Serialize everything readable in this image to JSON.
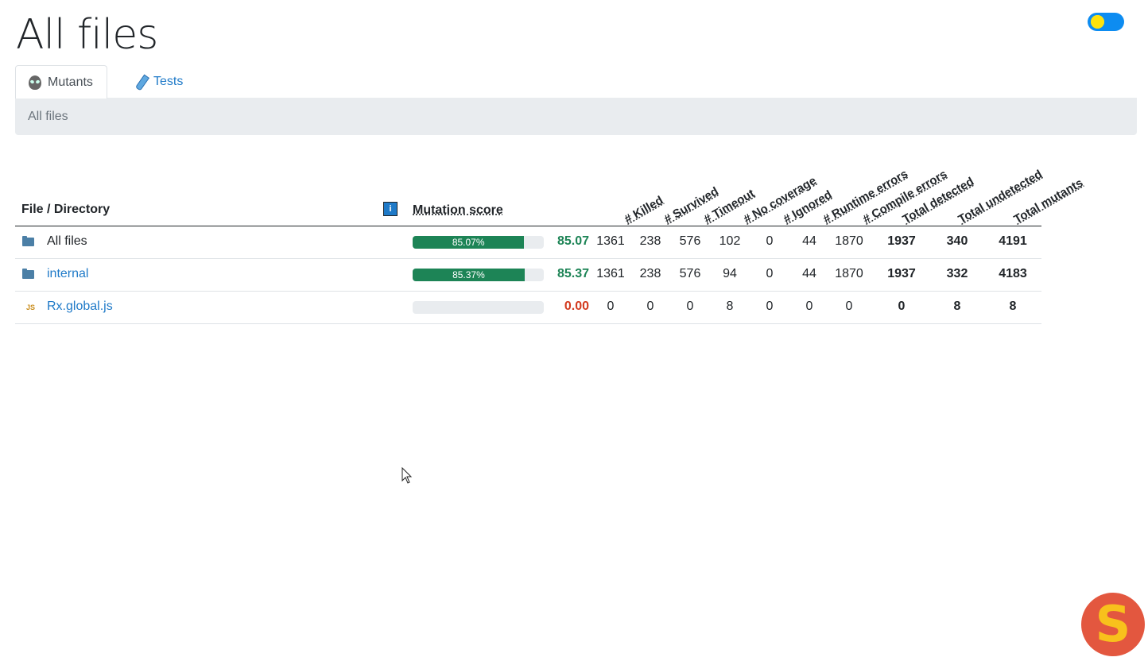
{
  "page": {
    "title": "All files"
  },
  "tabs": [
    {
      "label": "Mutants",
      "icon": "alien-icon",
      "active": true
    },
    {
      "label": "Tests",
      "icon": "test-tube-icon",
      "active": false
    }
  ],
  "breadcrumb": {
    "label": "All files"
  },
  "table": {
    "headers": {
      "file": "File / Directory",
      "info": "i",
      "score": "Mutation score",
      "killed": "# Killed",
      "survived": "# Survived",
      "timeout": "# Timeout",
      "no_coverage": "# No coverage",
      "ignored": "# Ignored",
      "runtime_errors": "# Runtime errors",
      "compile_errors": "# Compile errors",
      "total_detected": "Total detected",
      "total_undetected": "Total undetected",
      "total_mutants": "Total mutants"
    },
    "rows": [
      {
        "name": "All files",
        "type": "folder",
        "progress_label": "85.07%",
        "progress": 85.07,
        "score": "85.07",
        "score_color": "#1d8456",
        "killed": "1361",
        "survived": "238",
        "timeout": "576",
        "no_coverage": "102",
        "ignored": "0",
        "runtime_errors": "44",
        "compile_errors": "1870",
        "total_detected": "1937",
        "total_undetected": "340",
        "total_mutants": "4191"
      },
      {
        "name": "internal",
        "type": "folder",
        "progress_label": "85.37%",
        "progress": 85.37,
        "score": "85.37",
        "score_color": "#1d8456",
        "killed": "1361",
        "survived": "238",
        "timeout": "576",
        "no_coverage": "94",
        "ignored": "0",
        "runtime_errors": "44",
        "compile_errors": "1870",
        "total_detected": "1937",
        "total_undetected": "332",
        "total_mutants": "4183"
      },
      {
        "name": "Rx.global.js",
        "type": "js",
        "icon_text": "JS",
        "progress_label": "",
        "progress": 0,
        "score": "0.00",
        "score_color": "#d33b1f",
        "killed": "0",
        "survived": "0",
        "timeout": "0",
        "no_coverage": "8",
        "ignored": "0",
        "runtime_errors": "0",
        "compile_errors": "0",
        "total_detected": "0",
        "total_undetected": "8",
        "total_mutants": "8"
      }
    ]
  },
  "theme_toggle": {
    "icon": "sun-icon"
  },
  "logo": {
    "letter": "S"
  },
  "colors": {
    "accent": "#1f7ac8",
    "success": "#1d8456",
    "danger": "#d33b1f"
  }
}
